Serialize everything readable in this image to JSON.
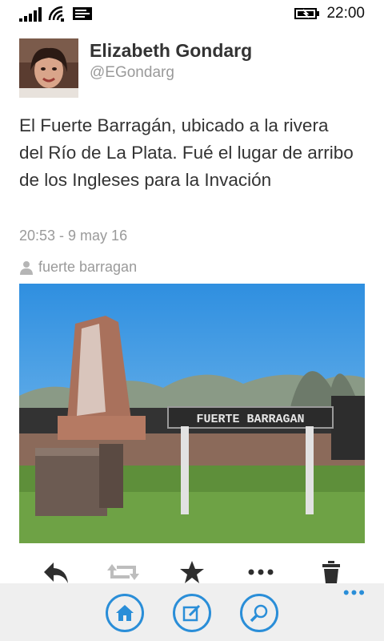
{
  "status_bar": {
    "time": "22:00",
    "signal_icon": "signal-strength-icon",
    "wifi_icon": "wifi-icon",
    "message_icon": "message-icon",
    "battery_icon": "battery-charging-icon"
  },
  "tweet": {
    "user_name": "Elizabeth Gondarg",
    "user_handle": "@EGondarg",
    "text": "El Fuerte Barragán, ubicado a la rivera del Río de La Plata. Fué el lugar de arribo de los Ingleses para la Invación",
    "timestamp": "20:53 - 9 may 16",
    "location": "fuerte barragan",
    "photo_sign_text": "FUERTE BARRAGAN"
  },
  "actions": {
    "reply_icon": "reply-icon",
    "retweet_icon": "retweet-icon",
    "favorite_icon": "star-icon",
    "more_icon": "more-icon",
    "delete_icon": "trash-icon"
  },
  "app_bar": {
    "buttons": [
      "home-icon",
      "compose-icon",
      "search-icon"
    ],
    "more_label": "•••"
  },
  "colors": {
    "accent": "#2a8ed8",
    "app_bar_bg": "#efefef",
    "muted_text": "#9a9a9a"
  }
}
